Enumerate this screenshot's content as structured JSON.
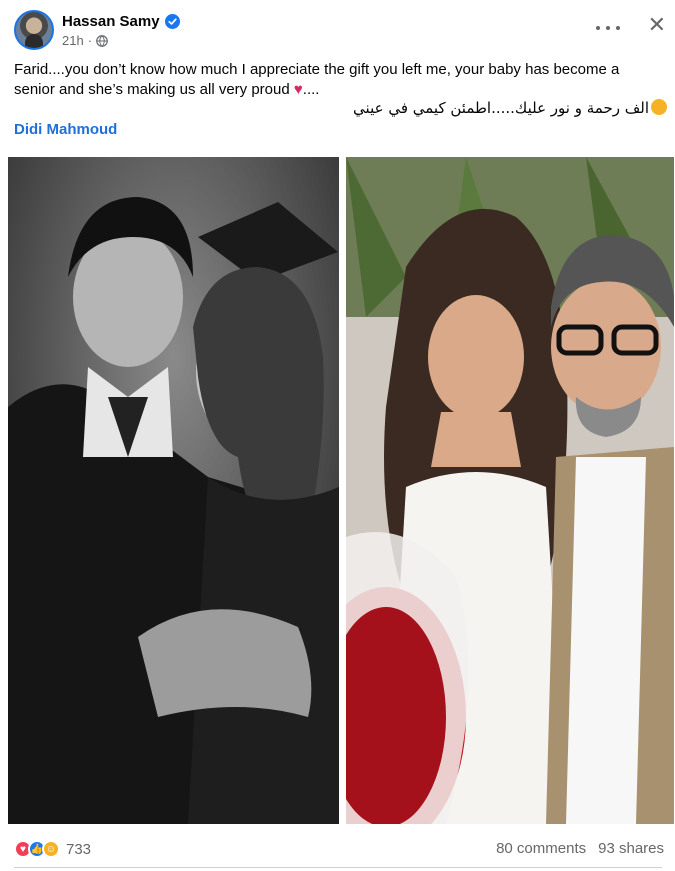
{
  "post": {
    "author": "Hassan Samy",
    "time": "21h",
    "privacy_icon": "globe-icon",
    "text_en": "Farid....you don’t know how much I appreciate the gift you left me, your baby has become a senior and she’s making us all very proud",
    "text_en_suffix": "....",
    "text_ar": "الف رحمة و نور عليك.....اطمئن كيمي في عيني",
    "mention": "Didi Mahmoud"
  },
  "stats": {
    "reactions_count": "733",
    "comments": "80 comments",
    "shares": "93 shares"
  },
  "colors": {
    "accent": "#1877f2",
    "mention": "#216fdb",
    "heart": "#e0245e",
    "secondary_text": "#65676b"
  }
}
